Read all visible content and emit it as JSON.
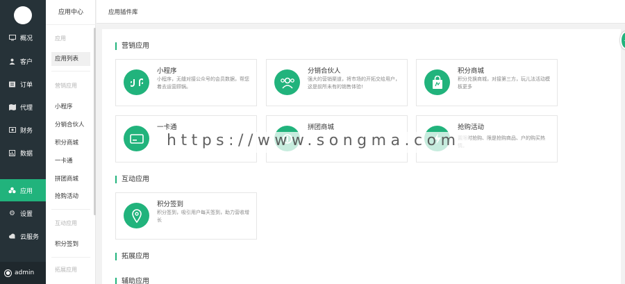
{
  "sidebar": {
    "items": [
      {
        "label": "概况",
        "icon": "monitor-icon"
      },
      {
        "label": "客户",
        "icon": "user-icon"
      },
      {
        "label": "订单",
        "icon": "list-icon"
      },
      {
        "label": "代理",
        "icon": "map-icon"
      },
      {
        "label": "财务",
        "icon": "money-icon"
      },
      {
        "label": "数据",
        "icon": "bar-chart-icon"
      },
      {
        "label": "应用",
        "icon": "apps-icon",
        "active": true
      },
      {
        "label": "设置",
        "icon": "gear-icon"
      },
      {
        "label": "云服务",
        "icon": "cloud-icon"
      }
    ],
    "user": "admin"
  },
  "subnav": {
    "title": "应用中心",
    "groups": [
      {
        "title": "应用",
        "items": [
          "应用列表"
        ]
      },
      {
        "title": "营销应用",
        "items": [
          "小程序",
          "分销合伙人",
          "积分商城",
          "一卡通",
          "拼团商城",
          "抢购活动"
        ]
      },
      {
        "title": "互动应用",
        "items": [
          "积分签到"
        ]
      },
      {
        "title": "拓展应用",
        "items": []
      }
    ]
  },
  "header": {
    "breadcrumb": "应用插件库"
  },
  "sections": {
    "marketing": {
      "title": "营销应用",
      "cards": [
        {
          "name": "小程序",
          "desc": "小程序，无缝对接公众号的会员数据，帮您着去运营顾锅。",
          "icon": "miniprogram-icon"
        },
        {
          "name": "分销合伙人",
          "desc": "强大的营销渠道，将市场的开拓交给用户，这是前所未有的销售体验!",
          "icon": "partners-icon"
        },
        {
          "name": "积分商城",
          "desc": "积分兑换商城，对接第三方，玩儿法活动模板更多",
          "icon": "shopping-bag-icon"
        },
        {
          "name": "一卡通",
          "desc": "",
          "icon": "card-icon"
        },
        {
          "name": "拼团商城",
          "desc": "",
          "icon": "group-buy-icon"
        },
        {
          "name": "抢购活动",
          "desc": "置限时抢购、限是抢购商品、户的购买热情。",
          "icon": "flash-sale-icon"
        }
      ]
    },
    "interactive": {
      "title": "互动应用",
      "cards": [
        {
          "name": "积分签到",
          "desc": "积分签到，吸引用户每天签到，助力营收增长",
          "icon": "location-pin-icon"
        }
      ]
    },
    "extended": {
      "title": "拓展应用"
    },
    "assist": {
      "title": "辅助应用"
    }
  },
  "watermark": "https://www.songma.com",
  "colors": {
    "accent": "#21b37c",
    "sidebar": "#263238"
  }
}
